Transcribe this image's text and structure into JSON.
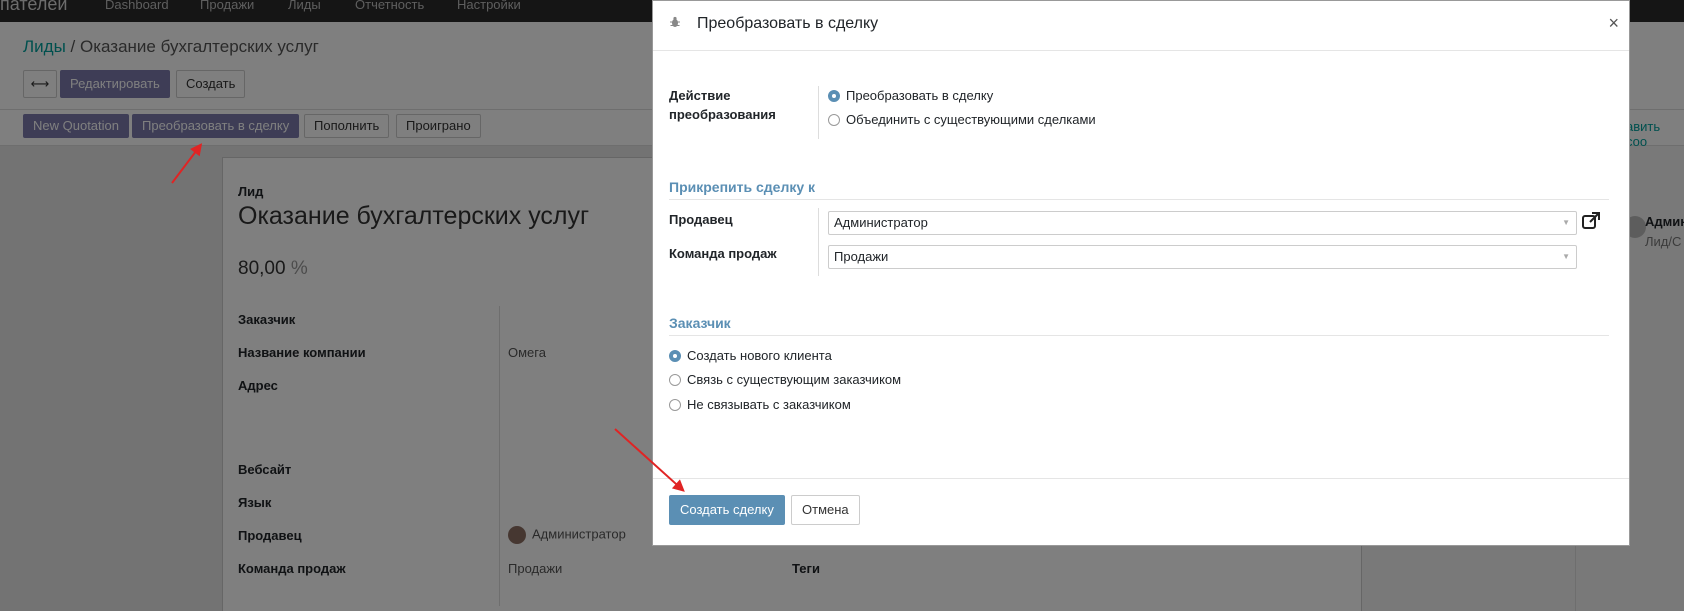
{
  "topbar": {
    "brand": "пателей",
    "menu": [
      "Dashboard",
      "Продажи",
      "Лиды",
      "Отчетность",
      "Настройки"
    ]
  },
  "control_panel": {
    "breadcrumb_root": "Лиды",
    "breadcrumb_sep": "/",
    "breadcrumb_current": "Оказание бухгалтерских услуг",
    "buttons": {
      "expand": "⟷",
      "edit": "Редактировать",
      "create": "Создать"
    }
  },
  "statusbar": {
    "buttons": [
      "New Quotation",
      "Преобразовать в сделку",
      "Пополнить",
      "Проиграно"
    ]
  },
  "sheet": {
    "type_label": "Лид",
    "title": "Оказание бухгалтерских услуг",
    "probability": "80,00",
    "probability_unit": "%",
    "fields": [
      {
        "label": "Заказчик",
        "value": ""
      },
      {
        "label": "Название компании",
        "value": "Омега"
      },
      {
        "label": "Адрес",
        "value": ""
      },
      {
        "label": "Вебсайт",
        "value": ""
      },
      {
        "label": "Язык",
        "value": ""
      },
      {
        "label": "Продавец",
        "value": "Администратор"
      },
      {
        "label": "Команда продаж",
        "value": "Продажи"
      }
    ],
    "tags_label": "Теги"
  },
  "chatter": {
    "link": "авить соо",
    "author": "Админ",
    "subtitle": "Лид/С"
  },
  "modal": {
    "title": "Преобразовать в сделку",
    "close": "×",
    "action_label": "Действие преобразования",
    "action_options": [
      {
        "label": "Преобразовать в сделку",
        "selected": true
      },
      {
        "label": "Объединить с существующими сделками",
        "selected": false
      }
    ],
    "attach_title": "Прикрепить сделку к",
    "salesperson_label": "Продавец",
    "salesperson_value": "Администратор",
    "team_label": "Команда продаж",
    "team_value": "Продажи",
    "customer_title": "Заказчик",
    "customer_options": [
      {
        "label": "Создать нового клиента",
        "selected": true
      },
      {
        "label": "Связь с существующим заказчиком",
        "selected": false
      },
      {
        "label": "Не связывать с заказчиком",
        "selected": false
      }
    ],
    "create_button": "Создать сделку",
    "cancel_button": "Отмена"
  },
  "colors": {
    "primary": "#5b8fb4",
    "annotation_arrow": "#e02424"
  }
}
